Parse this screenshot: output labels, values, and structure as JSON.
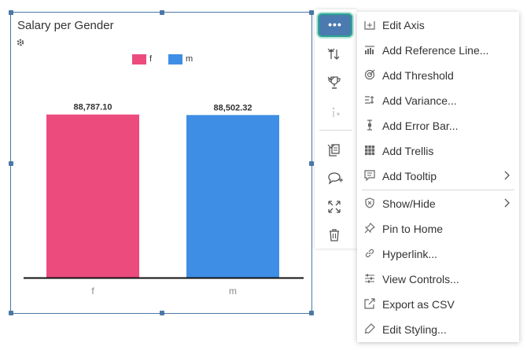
{
  "widget": {
    "title": "Salary per Gender"
  },
  "colors": {
    "female": "#ec4b7e",
    "male": "#3e8ee5",
    "accent": "#4a7ab0",
    "focus_ring": "#2aa68f",
    "frame": "#4a78a8"
  },
  "chart_data": {
    "type": "bar",
    "categories": [
      "f",
      "m"
    ],
    "series": [
      {
        "name": "f",
        "values": [
          88787.1,
          null
        ]
      },
      {
        "name": "m",
        "values": [
          null,
          88502.32
        ]
      }
    ],
    "values": [
      88787.1,
      88502.32
    ],
    "data_labels": [
      "88,787.10",
      "88,502.32"
    ],
    "legend": [
      "f",
      "m"
    ],
    "legend_position": "top-center",
    "title": "Salary per Gender",
    "xlabel": "",
    "ylabel": "",
    "ylim": [
      0,
      95000
    ],
    "grid": false
  },
  "toolbar": {
    "more_label": "•••",
    "icons": [
      "more-icon",
      "sort-icon",
      "trophy-icon",
      "info-icon",
      "copy-icon",
      "comment-icon",
      "fullscreen-icon",
      "delete-icon"
    ]
  },
  "menu": {
    "items": [
      {
        "label": "Edit Axis",
        "icon": "axis-icon"
      },
      {
        "label": "Add Reference Line...",
        "icon": "reference-line-icon"
      },
      {
        "label": "Add Threshold",
        "icon": "threshold-icon"
      },
      {
        "label": "Add Variance...",
        "icon": "variance-icon"
      },
      {
        "label": "Add Error Bar...",
        "icon": "error-bar-icon"
      },
      {
        "label": "Add Trellis",
        "icon": "trellis-icon"
      },
      {
        "label": "Add Tooltip",
        "icon": "tooltip-icon",
        "submenu": true
      },
      {
        "label": "Show/Hide",
        "icon": "show-hide-icon",
        "submenu": true
      },
      {
        "label": "Pin to Home",
        "icon": "pin-icon"
      },
      {
        "label": "Hyperlink...",
        "icon": "link-icon"
      },
      {
        "label": "View Controls...",
        "icon": "controls-icon"
      },
      {
        "label": "Export as CSV",
        "icon": "export-icon"
      },
      {
        "label": "Edit Styling...",
        "icon": "styling-icon"
      }
    ]
  }
}
